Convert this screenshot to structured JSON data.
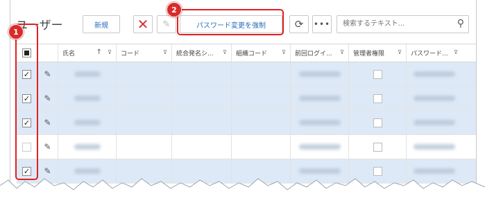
{
  "header": {
    "title": "ユーザー",
    "new_label": "新規",
    "delete_icon": "close-icon",
    "edit_icon": "pencil-icon",
    "force_password_label": "パスワード変更を強制",
    "refresh_icon": "refresh-icon",
    "more_label": "•••",
    "search_placeholder": "検索するテキスト..."
  },
  "columns": [
    {
      "label": "氏名",
      "sort": "↑"
    },
    {
      "label": "コード"
    },
    {
      "label": "統合発名シ..."
    },
    {
      "label": "組織コード"
    },
    {
      "label": "前回ログイ..."
    },
    {
      "label": "管理者権限"
    },
    {
      "label": "パスワード..."
    }
  ],
  "filter_glyph": "⊽",
  "rows": [
    {
      "checked": "✓",
      "selected": true
    },
    {
      "checked": "✓",
      "selected": true
    },
    {
      "checked": "✓",
      "selected": true
    },
    {
      "checked": "",
      "selected": false
    },
    {
      "checked": "✓",
      "selected": true
    }
  ],
  "annotations": [
    {
      "number": "1"
    },
    {
      "number": "2"
    }
  ],
  "colors": {
    "selected_row": "#dde9f6",
    "highlight": "#e02020",
    "accent": "#2a6fb8"
  }
}
